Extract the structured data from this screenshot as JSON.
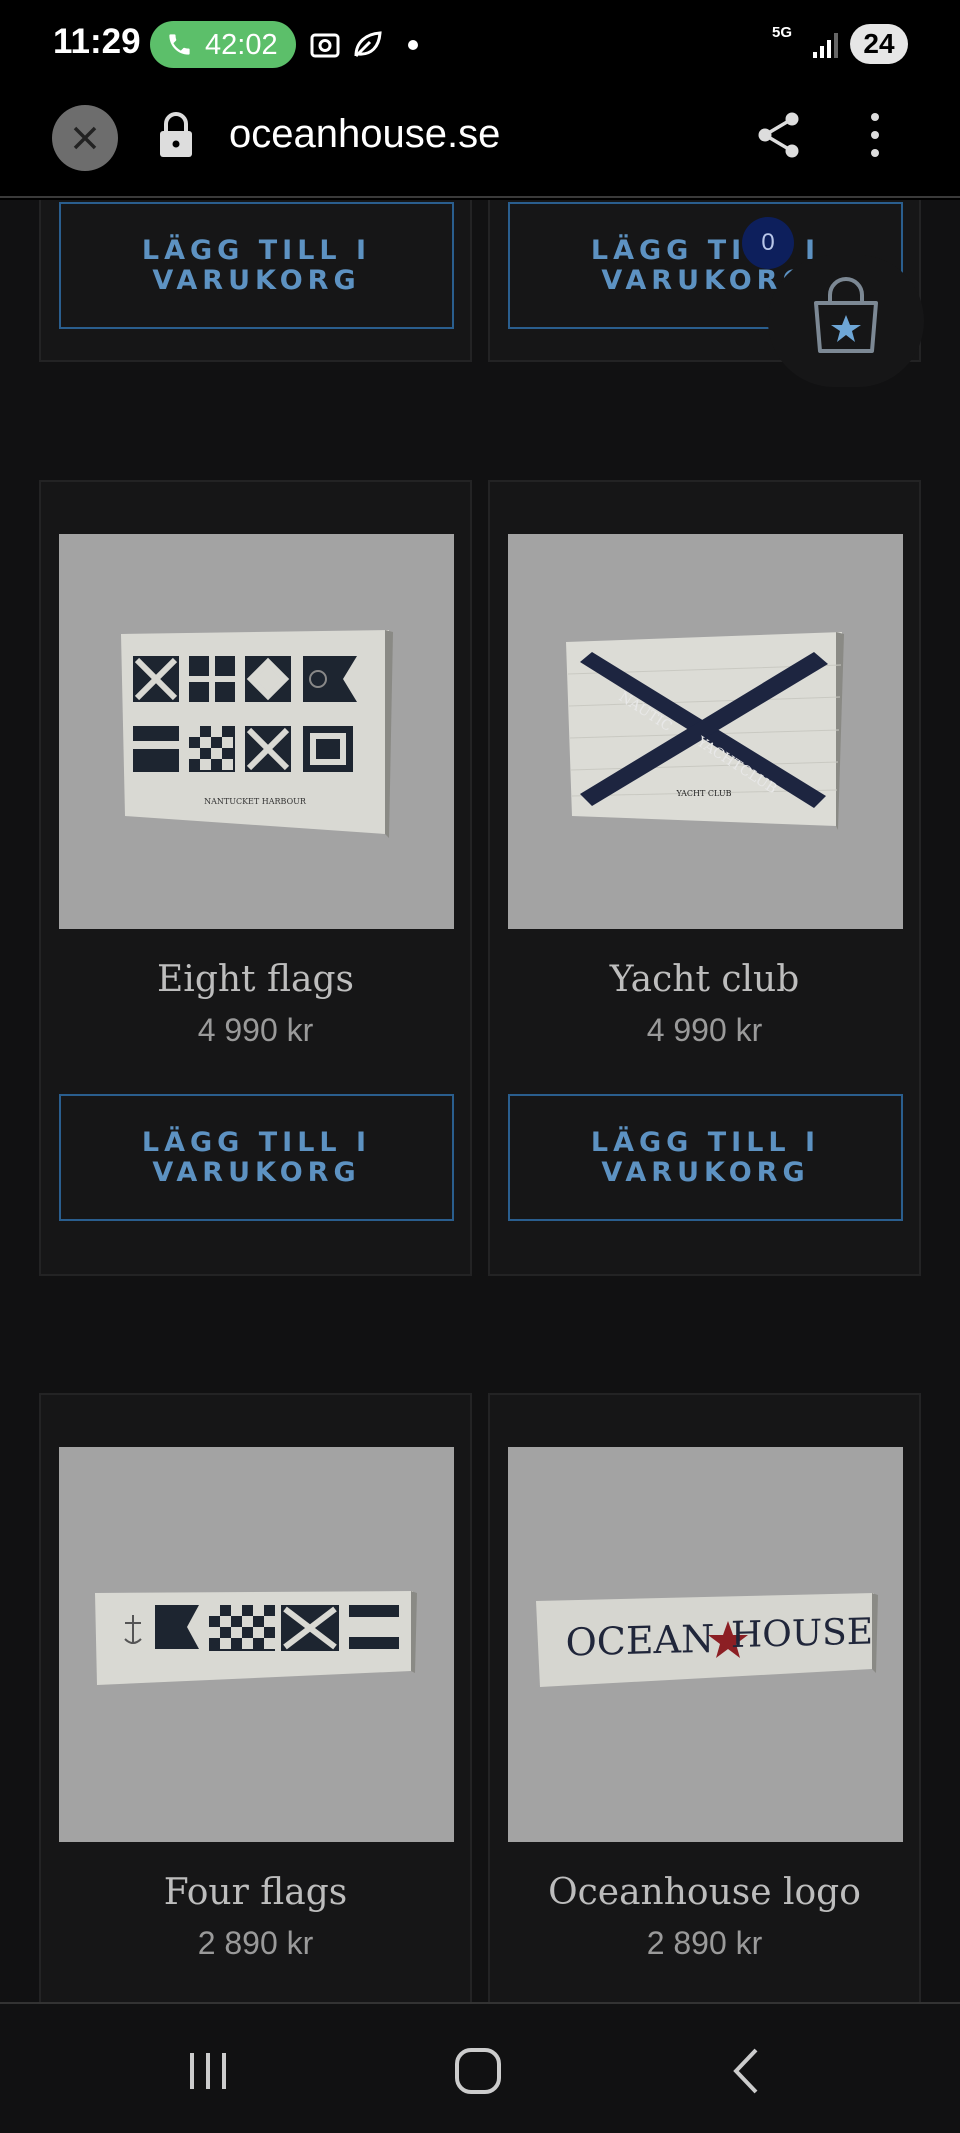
{
  "status_bar": {
    "time": "11:29",
    "call_timer": "42:02",
    "network": "5G",
    "battery": "24"
  },
  "browser": {
    "url": "oceanhouse.se",
    "icons": [
      "close-icon",
      "lock-icon",
      "share-icon",
      "more-vert-icon"
    ]
  },
  "cart": {
    "count": "0",
    "icon": "shopping-bag-star-icon"
  },
  "products": [
    {
      "name": "",
      "price": "",
      "button_label": "LÄGG TILL I VARUKORG"
    },
    {
      "name": "",
      "price": "",
      "button_label": "LÄGG TILL I VARUKORG"
    },
    {
      "name": "Eight flags",
      "price": "4 990 kr",
      "button_label": "LÄGG TILL I VARUKORG"
    },
    {
      "name": "Yacht club",
      "price": "4 990 kr",
      "button_label": "LÄGG TILL I VARUKORG"
    },
    {
      "name": "Four flags",
      "price": "2 890 kr"
    },
    {
      "name": "Oceanhouse logo",
      "price": "2 890 kr"
    }
  ],
  "image_text": {
    "eight_flags_caption": "NANTUCKET HARBOUR",
    "yacht_club_left": "NAUTIC",
    "yacht_club_right": "YACHTCLUB",
    "yacht_club_bottom": "YACHT CLUB",
    "logo_left": "OCEAN",
    "logo_right": "HOUSE"
  },
  "nav": {
    "icons": [
      "recent-apps-icon",
      "home-icon",
      "back-icon"
    ]
  },
  "colors": {
    "accent": "#2a5e8e",
    "button_text": "#5d92c2",
    "background": "#111112",
    "call_pill": "#5cbf6a"
  }
}
